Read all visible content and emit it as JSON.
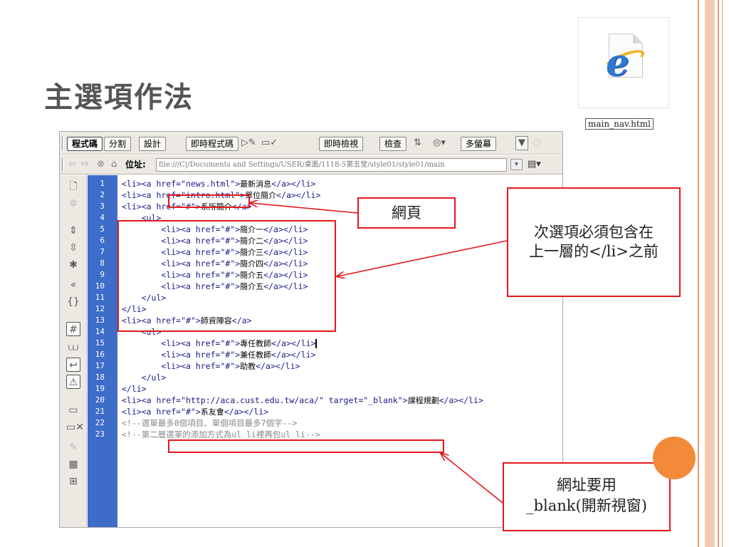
{
  "slide": {
    "title": "主選項作法"
  },
  "file_icon": {
    "label": "main_nav.html",
    "icon": "ie-file-icon"
  },
  "editor": {
    "toolbar": {
      "code": "程式碼",
      "split": "分割",
      "design": "設計",
      "live_code": "即時程式碼",
      "live_view": "即時檢視",
      "inspect": "檢查",
      "multiscreen": "多螢幕"
    },
    "address": {
      "label": "位址:",
      "value": "file:///C|/Documents and Settings/USER/桌面/1118-5第五堂/style01/style01/main"
    },
    "line_numbers": [
      "1",
      "2",
      "3",
      "4",
      "5",
      "6",
      "7",
      "8",
      "9",
      "10",
      "11",
      "12",
      "13",
      "14",
      "15",
      "16",
      "17",
      "18",
      "19",
      "20",
      "21",
      "22",
      "23"
    ],
    "lines": [
      {
        "code": "<li><a href=\"news.html\">",
        "text": "最新消息",
        "end": "</a></li>"
      },
      {
        "code": "<li><a href=\"intro.html\">",
        "text": "單位簡介",
        "end": "</a></li>"
      },
      {
        "code": "<li><a href=\"#\">",
        "text": "系所簡介",
        "end": "</a>"
      },
      {
        "code": "    <ul>",
        "text": "",
        "end": ""
      },
      {
        "code": "        <li><a href=\"#\">",
        "text": "簡介一",
        "end": "</a></li>"
      },
      {
        "code": "        <li><a href=\"#\">",
        "text": "簡介二",
        "end": "</a></li>"
      },
      {
        "code": "        <li><a href=\"#\">",
        "text": "簡介三",
        "end": "</a></li>"
      },
      {
        "code": "        <li><a href=\"#\">",
        "text": "簡介四",
        "end": "</a></li>"
      },
      {
        "code": "        <li><a href=\"#\">",
        "text": "簡介五",
        "end": "</a></li>"
      },
      {
        "code": "        <li><a href=\"#\">",
        "text": "簡介五",
        "end": "</a></li>"
      },
      {
        "code": "    </ul>",
        "text": "",
        "end": ""
      },
      {
        "code": "</li>",
        "text": "",
        "end": ""
      },
      {
        "code": "<li><a href=\"#\">",
        "text": "師資陣容",
        "end": "</a>"
      },
      {
        "code": "    <ul>",
        "text": "",
        "end": ""
      },
      {
        "code": "        <li><a href=\"#\">",
        "text": "專任教師",
        "end": "</a></li>"
      },
      {
        "code": "        <li><a href=\"#\">",
        "text": "兼任教師",
        "end": "</a></li>"
      },
      {
        "code": "        <li><a href=\"#\">",
        "text": "助教",
        "end": "</a></li>"
      },
      {
        "code": "    </ul>",
        "text": "",
        "end": ""
      },
      {
        "code": "</li>",
        "text": "",
        "end": ""
      },
      {
        "code": "<li><a href=\"http://aca.cust.edu.tw/aca/\" target=\"_blank\">",
        "text": "課程規劃",
        "end": "</a></li>"
      },
      {
        "code": "<li><a href=\"#\">",
        "text": "系友會",
        "end": "</a></li>"
      },
      {
        "code": "<!--",
        "text": "選單最多8個項目、單個項目最多7個字",
        "end": "-->"
      },
      {
        "code": "<!--",
        "text": "第二層選單的添加方式為ul li裡再包ul li",
        "end": "-->"
      }
    ]
  },
  "annotations": {
    "webpage": "網頁",
    "sub_items_line1": "次選項必須包含在",
    "sub_items_line2": "上一層的</li>之前",
    "blank_line1": "網址要用",
    "blank_line2": "_blank(開新視窗)"
  },
  "colors": {
    "accent_red": "#e3181c",
    "gutter_blue": "#3d6cc9",
    "frame_orange": "#e39a72",
    "dot_orange": "#f28a3a"
  }
}
